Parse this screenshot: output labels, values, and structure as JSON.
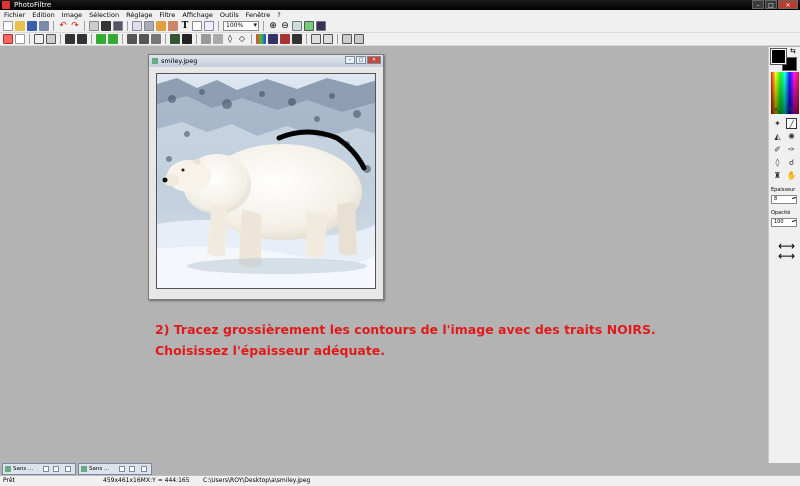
{
  "app": {
    "title": "PhotoFiltre",
    "window_controls": {
      "minimize": "–",
      "maximize": "□",
      "close": "✕"
    }
  },
  "menu": [
    "Fichier",
    "Edition",
    "Image",
    "Sélection",
    "Réglage",
    "Filtre",
    "Affichage",
    "Outils",
    "Fenêtre",
    "?"
  ],
  "toolbar": {
    "zoom_value": "100%",
    "text_tool_label": "T"
  },
  "document": {
    "title": "smiley.jpeg",
    "controls": {
      "minimize": "–",
      "maximize": "□",
      "close": "✕"
    }
  },
  "instructions": {
    "line1": "2) Tracez grossièrement les contours de l'image avec des traits NOIRS.",
    "line2": "Choisissez l'épaisseur adéquate."
  },
  "right_panel": {
    "thickness_label": "Epaisseur",
    "thickness_value": "8",
    "opacity_label": "Opacité",
    "opacity_value": "100",
    "foreground_color": "#000000",
    "background_color": "#000000"
  },
  "taskbar": {
    "tabs": [
      {
        "label": "Sans ..."
      },
      {
        "label": "Sans ..."
      }
    ]
  },
  "status": {
    "state": "Prêt",
    "image_size": "459x461x16M",
    "coords": "X:Y = 444:165",
    "path": "C:\\Users\\ROY\\Desktop\\a\\smiley.jpeg"
  },
  "colors": {
    "instruction_red": "#e01a1a",
    "workspace_gray": "#b3b3b3",
    "stroke_black": "#000000"
  }
}
